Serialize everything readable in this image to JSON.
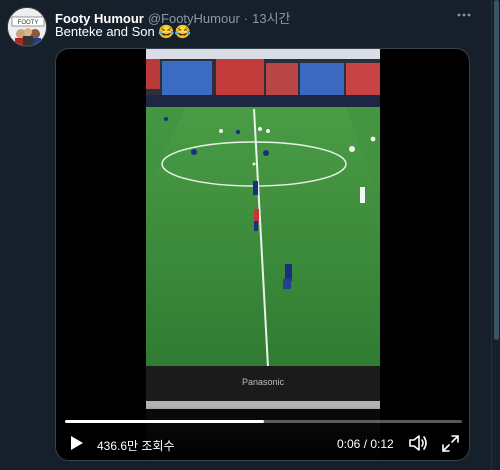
{
  "tweet": {
    "author_name": "Footy Humour",
    "author_handle": "@FootyHumour",
    "separator": "·",
    "time": "13시간",
    "text": "Benteke and Son 😂😂",
    "more_icon": "more-horizontal-icon"
  },
  "video": {
    "tv_brand": "Panasonic",
    "views": "436.6만 조회수",
    "timecode": "0:06 / 0:12",
    "progress": 0.5,
    "icons": {
      "play": "play-icon",
      "volume": "volume-icon",
      "fullscreen": "fullscreen-icon"
    }
  },
  "colors": {
    "background": "#15202b",
    "text_secondary": "#8899a6",
    "border": "#38444d",
    "pitch": "#3a8a3c"
  }
}
